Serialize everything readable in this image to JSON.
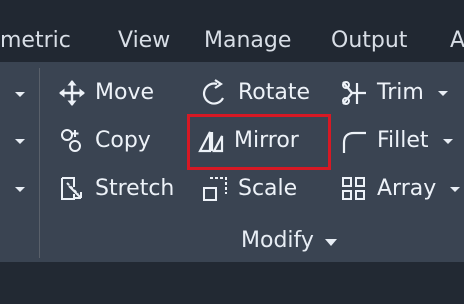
{
  "tabs": [
    {
      "label": "metric"
    },
    {
      "label": "View"
    },
    {
      "label": "Manage"
    },
    {
      "label": "Output"
    },
    {
      "label": "A"
    }
  ],
  "commands": [
    {
      "label": "Move",
      "icon": "move-icon"
    },
    {
      "label": "Rotate",
      "icon": "rotate-icon"
    },
    {
      "label": "Trim",
      "icon": "trim-icon"
    },
    {
      "label": "Copy",
      "icon": "copy-icon"
    },
    {
      "label": "Mirror",
      "icon": "mirror-icon"
    },
    {
      "label": "Fillet",
      "icon": "fillet-icon"
    },
    {
      "label": "Stretch",
      "icon": "stretch-icon"
    },
    {
      "label": "Scale",
      "icon": "scale-icon"
    },
    {
      "label": "Array",
      "icon": "array-icon"
    }
  ],
  "panel": {
    "title": "Modify"
  },
  "colors": {
    "tab_background": "#212832",
    "ribbon_background": "#3a4452",
    "text": "#edf2f8",
    "highlight": "#d71924"
  }
}
